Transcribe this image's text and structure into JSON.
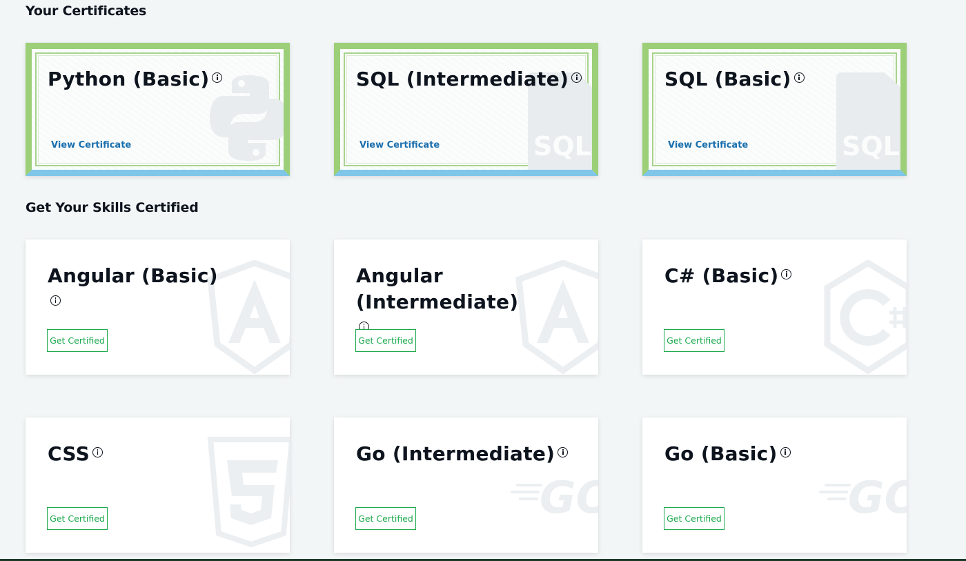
{
  "sections": {
    "certificates_title": "Your Certificates",
    "skills_title": "Get Your Skills Certified"
  },
  "certificates": [
    {
      "title": "Python (Basic)",
      "link": "View Certificate",
      "watermark": "python-logo-icon"
    },
    {
      "title": "SQL (Intermediate)",
      "link": "View Certificate",
      "watermark": "sql-logo-icon",
      "watermark_text": "SQL"
    },
    {
      "title": "SQL (Basic)",
      "link": "View Certificate",
      "watermark": "sql-logo-icon",
      "watermark_text": "SQL"
    }
  ],
  "skills": [
    {
      "title": "Angular (Basic)",
      "button": "Get Certified",
      "watermark": "angular-logo-icon"
    },
    {
      "title": "Angular (Intermediate)",
      "button": "Get Certified",
      "watermark": "angular-logo-icon"
    },
    {
      "title": "C# (Basic)",
      "button": "Get Certified",
      "watermark": "csharp-logo-icon"
    },
    {
      "title": "CSS",
      "button": "Get Certified",
      "watermark": "css3-logo-icon"
    },
    {
      "title": "Go (Intermediate)",
      "button": "Get Certified",
      "watermark": "go-logo-icon",
      "watermark_text": "GO"
    },
    {
      "title": "Go (Basic)",
      "button": "Get Certified",
      "watermark": "go-logo-icon",
      "watermark_text": "GO"
    }
  ],
  "colors": {
    "page_bg": "#f3f6f7",
    "link": "#1a6fae",
    "button": "#1ba94c",
    "title": "#0e141e",
    "cert_border_top": "#9ccf78",
    "cert_border_bottom": "#7fc6e8"
  }
}
